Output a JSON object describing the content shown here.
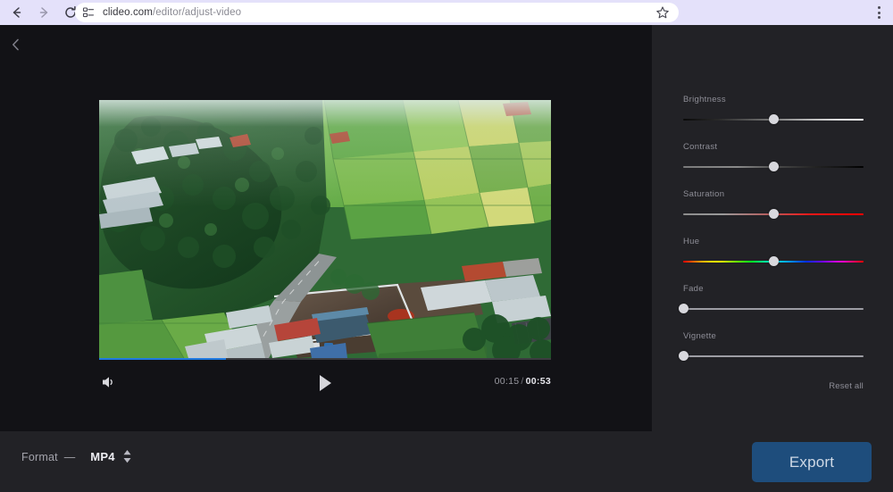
{
  "browser": {
    "back_icon": "arrow-left-icon",
    "forward_icon": "arrow-right-icon",
    "reload_icon": "reload-icon",
    "site_info_icon": "site-settings-icon",
    "url_host": "clideo.com",
    "url_path": "/editor/adjust-video",
    "bookmark_icon": "star-icon",
    "menu_icon": "kebab-menu-icon",
    "chrome_bg": "#e4e1fa"
  },
  "editor": {
    "back_label": "back-chevron",
    "stage_bg": "#121216",
    "panel_bg": "#222226"
  },
  "player": {
    "volume_icon": "speaker-icon",
    "play_icon": "play-icon",
    "current_time": "00:15",
    "separator": "/",
    "total_time": "00:53",
    "progress_percent": 28,
    "progress_color": "#1f7ae0"
  },
  "adjust_panel": {
    "sliders": [
      {
        "label": "Brightness",
        "value_percent": 50,
        "track": "dark-to-white"
      },
      {
        "label": "Contrast",
        "value_percent": 50,
        "track": "gray-to-black"
      },
      {
        "label": "Saturation",
        "value_percent": 50,
        "track": "gray-to-red"
      },
      {
        "label": "Hue",
        "value_percent": 50,
        "track": "rainbow"
      },
      {
        "label": "Fade",
        "value_percent": 0,
        "track": "plain"
      },
      {
        "label": "Vignette",
        "value_percent": 0,
        "track": "plain"
      }
    ],
    "reset_label": "Reset all"
  },
  "bottom_bar": {
    "format_label": "Format",
    "format_dash": "—",
    "format_value": "MP4",
    "format_caret_icon": "stepper-updown-icon",
    "export_label": "Export",
    "export_color": "#1e4d7c"
  }
}
